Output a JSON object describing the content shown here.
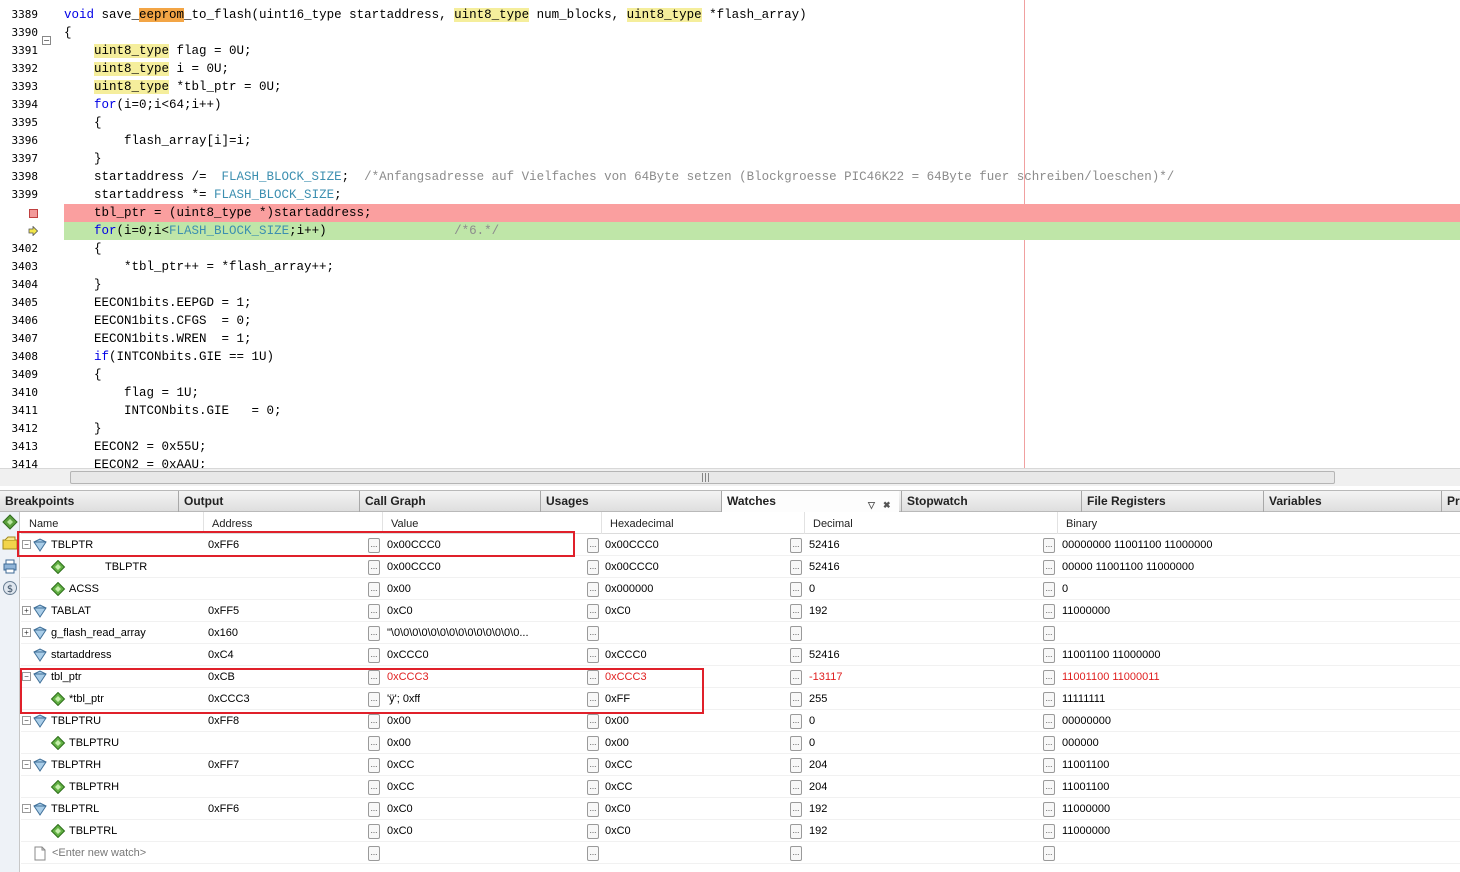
{
  "editor": {
    "lines": [
      {
        "num": "3389",
        "marker": "",
        "html_key": "l3389"
      },
      {
        "num": "3390",
        "marker": "fold"
      },
      {
        "num": "3391"
      },
      {
        "num": "3392"
      },
      {
        "num": "3393"
      },
      {
        "num": "3394"
      },
      {
        "num": "3395"
      },
      {
        "num": "3396"
      },
      {
        "num": "3397"
      },
      {
        "num": "3398"
      },
      {
        "num": "3399"
      },
      {
        "num": "",
        "marker": "breakpoint"
      },
      {
        "num": "",
        "marker": "pc"
      },
      {
        "num": "3402"
      },
      {
        "num": "3403"
      },
      {
        "num": "3404"
      },
      {
        "num": "3405"
      },
      {
        "num": "3406"
      },
      {
        "num": "3407"
      },
      {
        "num": "3408"
      },
      {
        "num": "3409"
      },
      {
        "num": "3410"
      },
      {
        "num": "3411"
      },
      {
        "num": "3412"
      },
      {
        "num": "3413"
      },
      {
        "num": "3414"
      }
    ],
    "fold_symbol": "−",
    "code": {
      "l3389": [
        "void",
        " save_",
        "eeprom",
        "_to_flash(uint16_type startaddress, ",
        "uint8_type",
        " num_blocks, ",
        "uint8_type",
        " *flash_array)"
      ],
      "l3390": "{",
      "l3391": [
        "uint8_type",
        " flag = 0U;"
      ],
      "l3392": [
        "uint8_type",
        " i = 0U;"
      ],
      "l3393": [
        "uint8_type",
        " *tbl_ptr = 0U;"
      ],
      "l3394": [
        "for",
        "(i=0;i<64;i++)"
      ],
      "l3395": "{",
      "l3396": "flash_array[i]=i;",
      "l3397": "}",
      "l3398": [
        "startaddress /=  ",
        "FLASH_BLOCK_SIZE",
        ";  ",
        "/*Anfangsadresse auf Vielfaches von 64Byte setzen (Blockgroesse PIC46K22 = 64Byte fuer schreiben/loeschen)*/"
      ],
      "l3399": [
        "startaddress *= ",
        "FLASH_BLOCK_SIZE",
        ";"
      ],
      "l3400": "tbl_ptr = (uint8_type *)startaddress;",
      "l3401": [
        "for",
        "(i=0;i<",
        "FLASH_BLOCK_SIZE",
        ";i++)",
        "                 /*6.*/"
      ],
      "l3402": "{",
      "l3403": "*tbl_ptr++ = *flash_array++;",
      "l3404": "}",
      "l3405": "EECON1bits.EEPGD = 1;",
      "l3406": "EECON1bits.CFGS  = 0;",
      "l3407": "EECON1bits.WREN  = 1;",
      "l3408": [
        "if",
        "(INTCONbits.GIE == 1U)"
      ],
      "l3409": "{",
      "l3410": "flag = 1U;",
      "l3411": "INTCONbits.GIE   = 0;",
      "l3412": "}",
      "l3413": "EECON2 = 0x55U;",
      "l3414": "EECON2 = 0xAAU;"
    },
    "scroll_grip": "|||"
  },
  "tabs": [
    {
      "label": "Breakpoints"
    },
    {
      "label": "Output"
    },
    {
      "label": "Call Graph"
    },
    {
      "label": "Usages"
    },
    {
      "label": "Watches",
      "active": true
    },
    {
      "label": "Stopwatch"
    },
    {
      "label": "File Registers"
    },
    {
      "label": "Variables"
    },
    {
      "label": "Pr"
    }
  ],
  "watches_controls": {
    "minimize": "▽",
    "close": "✖"
  },
  "watches": {
    "columns": [
      "Name",
      "Address",
      "Value",
      "Hexadecimal",
      "Decimal",
      "Binary"
    ],
    "ellipsis": "...",
    "rows": [
      {
        "name": "TBLPTR",
        "address": "0xFF6",
        "value": "0x00CCC0",
        "hex": "0x00CCC0",
        "dec": "52416",
        "bin": "00000000 11001100 11000000",
        "level": 0,
        "expander": "−",
        "icon": "sfr"
      },
      {
        "name": "TBLPTR",
        "address": "",
        "value": "0x00CCC0",
        "hex": "0x00CCC0",
        "dec": "52416",
        "bin": "00000 11001100 11000000",
        "level": 1,
        "icon": "field",
        "name_indent": true
      },
      {
        "name": "ACSS",
        "address": "",
        "value": "0x00",
        "hex": "0x000000",
        "dec": "0",
        "bin": "0",
        "level": 1,
        "icon": "field"
      },
      {
        "name": "TABLAT",
        "address": "0xFF5",
        "value": "0xC0",
        "hex": "0xC0",
        "dec": "192",
        "bin": "11000000",
        "level": 0,
        "expander": "+",
        "icon": "sfr"
      },
      {
        "name": "g_flash_read_array",
        "address": "0x160",
        "value": "\"\\0\\0\\0\\0\\0\\0\\0\\0\\0\\0\\0\\0\\0\\0...",
        "hex": "",
        "dec": "",
        "bin": "",
        "level": 0,
        "expander": "+",
        "icon": "var"
      },
      {
        "name": "startaddress",
        "address": "0xC4",
        "value": "0xCCC0",
        "hex": "0xCCC0",
        "dec": "52416",
        "bin": "11001100 11000000",
        "level": 0,
        "icon": "sfr"
      },
      {
        "name": "tbl_ptr",
        "address": "0xCB",
        "value": "0xCCC3",
        "hex": "0xCCC3",
        "dec": "-13117",
        "bin": "11001100 11000011",
        "level": 0,
        "expander": "−",
        "icon": "sfr",
        "changed": true
      },
      {
        "name": "*tbl_ptr",
        "address": "0xCCC3",
        "value": "'ÿ'; 0xff",
        "hex": "0xFF",
        "dec": "255",
        "bin": "11111111",
        "level": 1,
        "icon": "field"
      },
      {
        "name": "TBLPTRU",
        "address": "0xFF8",
        "value": "0x00",
        "hex": "0x00",
        "dec": "0",
        "bin": "00000000",
        "level": 0,
        "expander": "−",
        "icon": "sfr"
      },
      {
        "name": "TBLPTRU",
        "address": "",
        "value": "0x00",
        "hex": "0x00",
        "dec": "0",
        "bin": "000000",
        "level": 1,
        "icon": "field"
      },
      {
        "name": "TBLPTRH",
        "address": "0xFF7",
        "value": "0xCC",
        "hex": "0xCC",
        "dec": "204",
        "bin": "11001100",
        "level": 0,
        "expander": "−",
        "icon": "sfr"
      },
      {
        "name": "TBLPTRH",
        "address": "",
        "value": "0xCC",
        "hex": "0xCC",
        "dec": "204",
        "bin": "11001100",
        "level": 1,
        "icon": "field"
      },
      {
        "name": "TBLPTRL",
        "address": "0xFF6",
        "value": "0xC0",
        "hex": "0xC0",
        "dec": "192",
        "bin": "11000000",
        "level": 0,
        "expander": "−",
        "icon": "sfr"
      },
      {
        "name": "TBLPTRL",
        "address": "",
        "value": "0xC0",
        "hex": "0xC0",
        "dec": "192",
        "bin": "11000000",
        "level": 1,
        "icon": "field"
      }
    ],
    "new_watch_placeholder": "<Enter new watch>"
  },
  "colors": {
    "breakpoint_line": "#fa9f9f",
    "pc_line": "#bfe6a8",
    "changed_value": "#e02020",
    "annotation_box": "#e0202a"
  }
}
